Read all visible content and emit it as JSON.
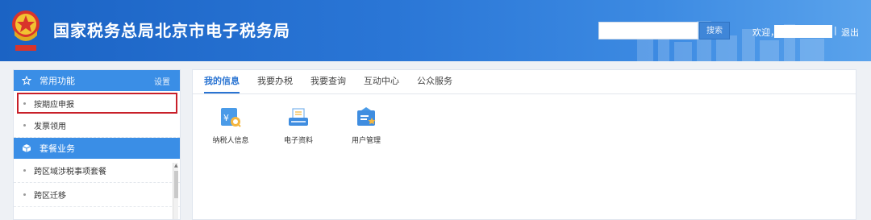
{
  "header": {
    "site_title": "国家税务总局北京市电子税务局",
    "search_placeholder": "",
    "search_button": "搜索",
    "welcome": "欢迎，",
    "separator": "|",
    "logout": "退出",
    "gradient_start": "#1b63c4",
    "gradient_end": "#5aa3ec"
  },
  "sidebar": {
    "groups": [
      {
        "icon": "star-icon",
        "title": "常用功能",
        "setting": "设置",
        "items": [
          "按期应申报",
          "发票领用"
        ]
      },
      {
        "icon": "cube-icon",
        "title": "套餐业务",
        "items": [
          "跨区域涉税事项套餐",
          "跨区迁移"
        ]
      }
    ],
    "highlight_color": "#c8202a"
  },
  "main": {
    "tabs": [
      "我的信息",
      "我要办税",
      "我要查询",
      "互动中心",
      "公众服务"
    ],
    "active_tab": "我的信息",
    "apps": [
      {
        "icon": "taxpayer-info-icon",
        "label": "纳税人信息"
      },
      {
        "icon": "electronic-document-icon",
        "label": "电子资料"
      },
      {
        "icon": "user-management-icon",
        "label": "用户管理"
      }
    ],
    "accent": "#2a74d2"
  }
}
